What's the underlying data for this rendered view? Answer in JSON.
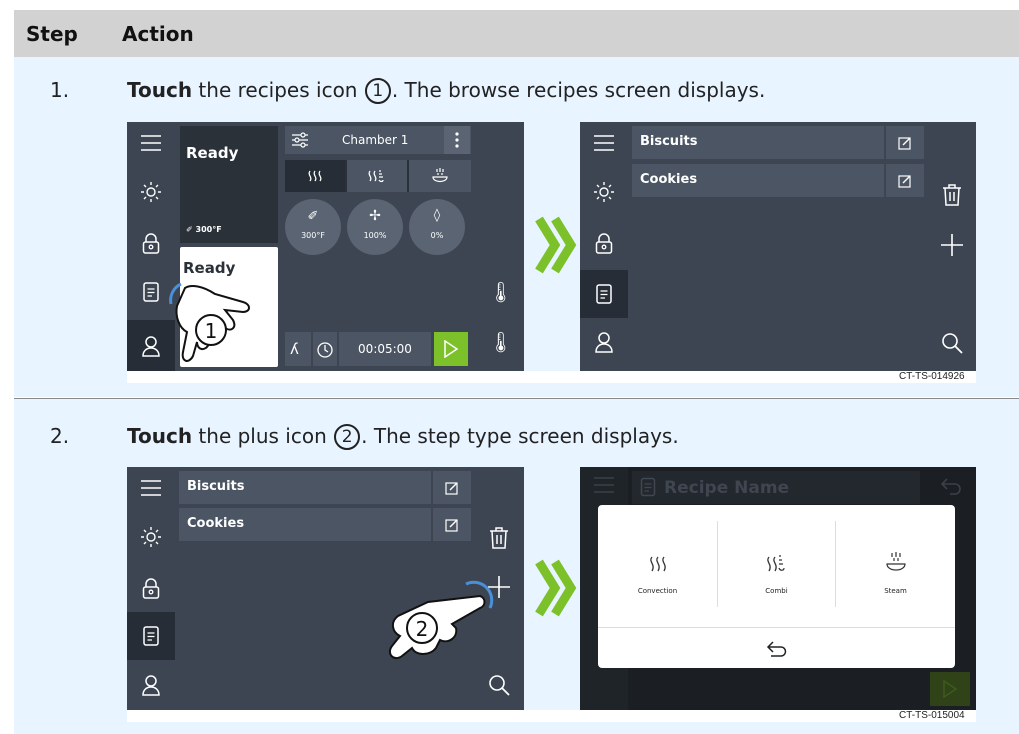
{
  "header": {
    "step": "Step",
    "action": "Action"
  },
  "steps": [
    {
      "number": "1.",
      "verb": "Touch",
      "text_before": " the recipes icon ",
      "callout": "1",
      "text_after": ". The browse recipes screen displays.",
      "figure_id": "CT-TS-014926",
      "left_screen": {
        "status_top": "Ready",
        "temp_top": "300°F",
        "status_bottom": "Ready",
        "chamber": "Chamber 1",
        "dial_temp": "300°F",
        "dial_fan": "100%",
        "dial_humidity": "0%",
        "timer": "00:05:00"
      },
      "right_screen": {
        "recipes": [
          "Biscuits",
          "Cookies"
        ]
      }
    },
    {
      "number": "2.",
      "verb": "Touch",
      "text_before": " the plus icon ",
      "callout": "2",
      "text_after": ". The step type screen displays.",
      "figure_id": "CT-TS-015004",
      "left_screen": {
        "recipes": [
          "Biscuits",
          "Cookies"
        ]
      },
      "right_screen": {
        "title": "Recipe Name",
        "options": [
          "Convection",
          "Combi",
          "Steam"
        ]
      }
    }
  ],
  "colors": {
    "screen_bg": "#3c4551",
    "panel": "#4b5563",
    "accent_green": "#7cc02a",
    "row_bg": "#e8f4ff",
    "header_bg": "#d2d2d2"
  }
}
